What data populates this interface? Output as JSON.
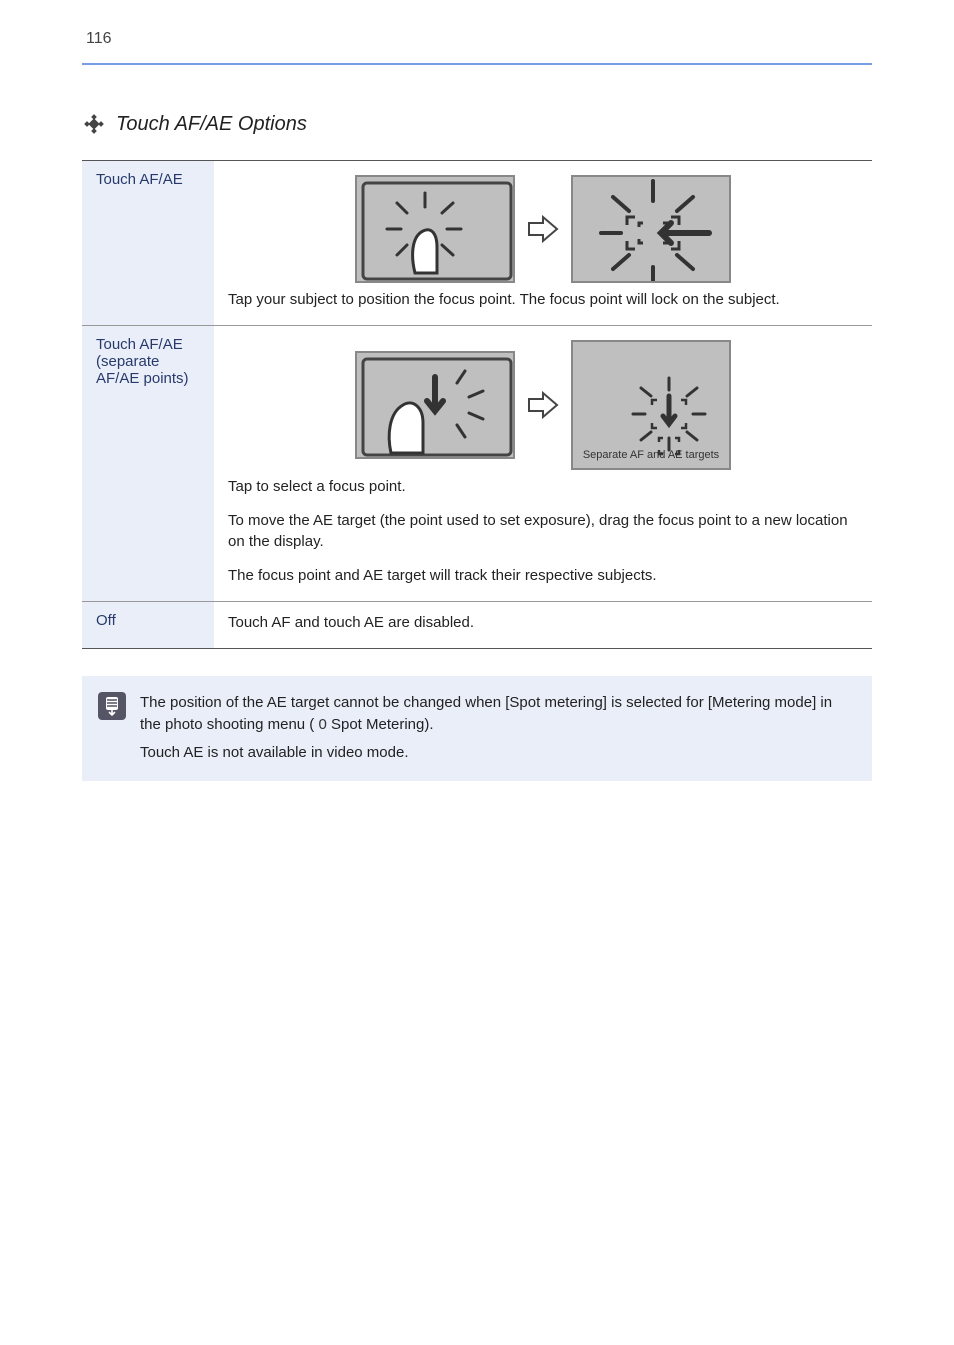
{
  "page_number_top": "116",
  "section_title": "Touch AF/AE Options",
  "table": {
    "row1": {
      "label": "Touch AF/AE",
      "body": "Tap your subject to position the focus point. The focus point will lock on the subject."
    },
    "row2": {
      "label": "Touch AF/AE (separate AF/AE points)",
      "body": [
        "Tap to select a focus point.",
        "To move the AE target (the point used to set exposure), drag the focus point to a new location on the display.",
        "The focus point and AE target will track their respective subjects."
      ],
      "sep_label": "Separate AF and AE targets"
    },
    "row3": {
      "label": "Off",
      "body": "Touch AF and touch AE are disabled."
    }
  },
  "note": {
    "p1": "The position of the AE target cannot be changed when [Spot metering] is selected for [Metering mode] in the photo shooting menu (",
    "p1_ref": "Spot Metering",
    "p1_end": ").",
    "p2": "Touch AE is not available in video mode."
  },
  "ref_symbol": "0"
}
